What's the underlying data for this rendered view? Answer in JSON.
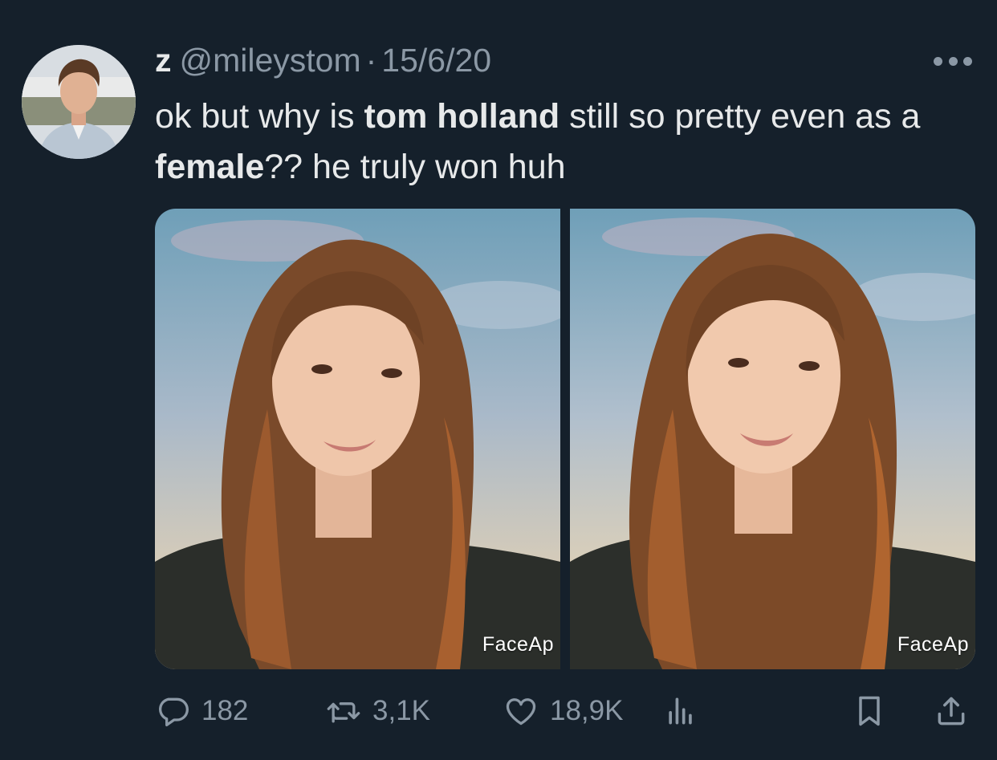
{
  "tweet": {
    "author_name": "z",
    "handle": "@mileystom",
    "separator": "·",
    "date": "15/6/20",
    "text_parts": {
      "p1": "ok but why is ",
      "p2": "tom holland",
      "p3": " still so pretty even as a ",
      "p4": "female",
      "p5": "?? he truly won huh"
    },
    "images": [
      {
        "watermark": "FaceAp"
      },
      {
        "watermark": "FaceAp"
      }
    ]
  },
  "actions": {
    "replies": "182",
    "retweets": "3,1K",
    "likes": "18,9K"
  },
  "icons": [
    "more-icon",
    "reply-icon",
    "retweet-icon",
    "like-icon",
    "views-icon",
    "bookmark-icon",
    "share-icon"
  ],
  "colors": {
    "background": "#15202b",
    "text": "#e7e9ea",
    "muted": "#8b98a5"
  }
}
